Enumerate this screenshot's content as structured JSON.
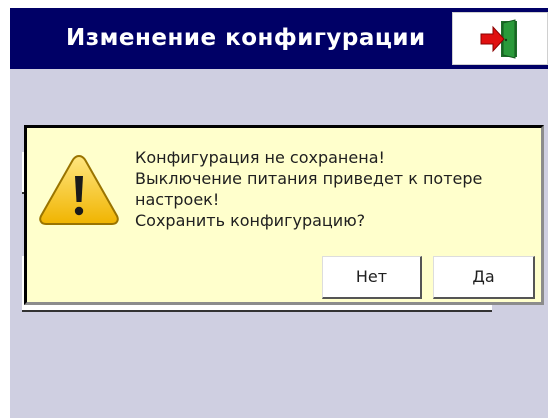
{
  "header": {
    "title": "Изменение конфигурации",
    "exit_icon": "exit-door-icon"
  },
  "dialog": {
    "icon": "warning-icon",
    "message_lines": [
      "Конфигурация не сохранена!",
      "Выключение питания приведет к потере",
      "настроек!",
      "Сохранить конфигурацию?"
    ],
    "no_label": "Нет",
    "yes_label": "Да"
  },
  "colors": {
    "header_bg": "#000066",
    "screen_bg": "#cfcfe1",
    "dialog_bg": "#ffffcc",
    "warning_fill": "#f5c000",
    "exit_arrow": "#e01010",
    "exit_door": "#2a9a3a"
  }
}
